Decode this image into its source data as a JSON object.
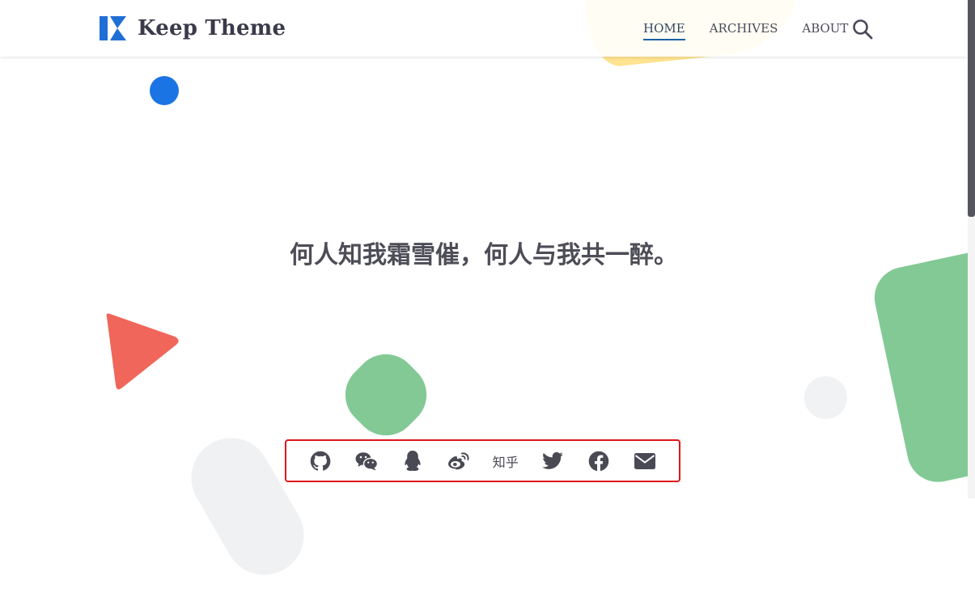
{
  "header": {
    "logo_text": "Keep Theme",
    "nav": [
      {
        "label": "HOME",
        "active": true
      },
      {
        "label": "ARCHIVES",
        "active": false
      },
      {
        "label": "ABOUT",
        "active": false
      }
    ],
    "search_icon": "search-icon"
  },
  "hero": {
    "quote": "何人知我霜雪催，何人与我共一醉。"
  },
  "social": {
    "zhihu_label": "知乎",
    "icons": [
      "github-icon",
      "wechat-icon",
      "qq-icon",
      "weibo-icon",
      "zhihu",
      "twitter-icon",
      "facebook-icon",
      "email-icon"
    ]
  },
  "colors": {
    "accent": "#1b5fa8",
    "text": "#4d4d57",
    "highlight_border": "#e0161b"
  }
}
